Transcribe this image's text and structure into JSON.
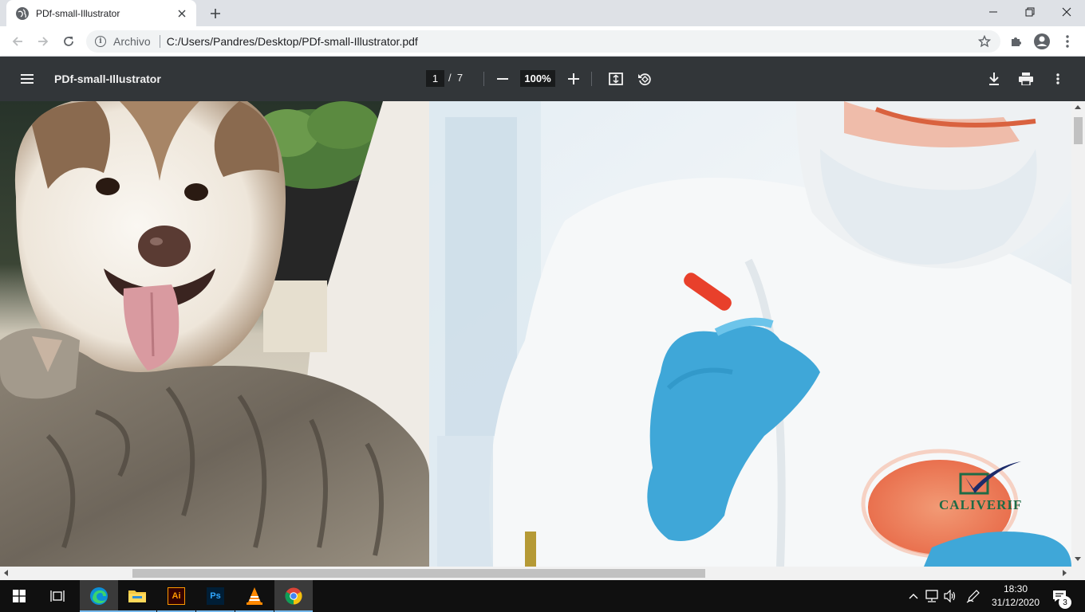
{
  "browser": {
    "tab_title": "PDf-small-Illustrator",
    "omnibox_scheme": "Archivo",
    "omnibox_url": "C:/Users/Pandres/Desktop/PDf-small-Illustrator.pdf"
  },
  "pdf_viewer": {
    "title": "PDf-small-Illustrator",
    "current_page": "1",
    "page_separator": "/",
    "total_pages": "7",
    "zoom": "100%"
  },
  "document": {
    "logo_text": "CALIVERIF"
  },
  "taskbar": {
    "apps": [
      "start",
      "task-view",
      "edge",
      "file-explorer",
      "illustrator",
      "photoshop",
      "vlc",
      "chrome"
    ],
    "ai_label": "Ai",
    "ps_label": "Ps",
    "time": "18:30",
    "date": "31/12/2020",
    "notification_count": "3"
  },
  "colors": {
    "pdf_toolbar": "#323639",
    "chrome_frame": "#dee1e6",
    "taskbar": "#101010",
    "logo_green": "#1f6b46",
    "logo_navy": "#1c2b6a"
  },
  "icons": [
    "globe-icon",
    "close-icon",
    "plus-icon",
    "minimize-icon",
    "maximize-icon",
    "back-icon",
    "forward-icon",
    "reload-icon",
    "info-icon",
    "star-icon",
    "extensions-icon",
    "profile-icon",
    "menu-kebab-icon",
    "hamburger-icon",
    "zoom-out-icon",
    "zoom-in-icon",
    "fit-page-icon",
    "rotate-icon",
    "download-icon",
    "print-icon"
  ]
}
